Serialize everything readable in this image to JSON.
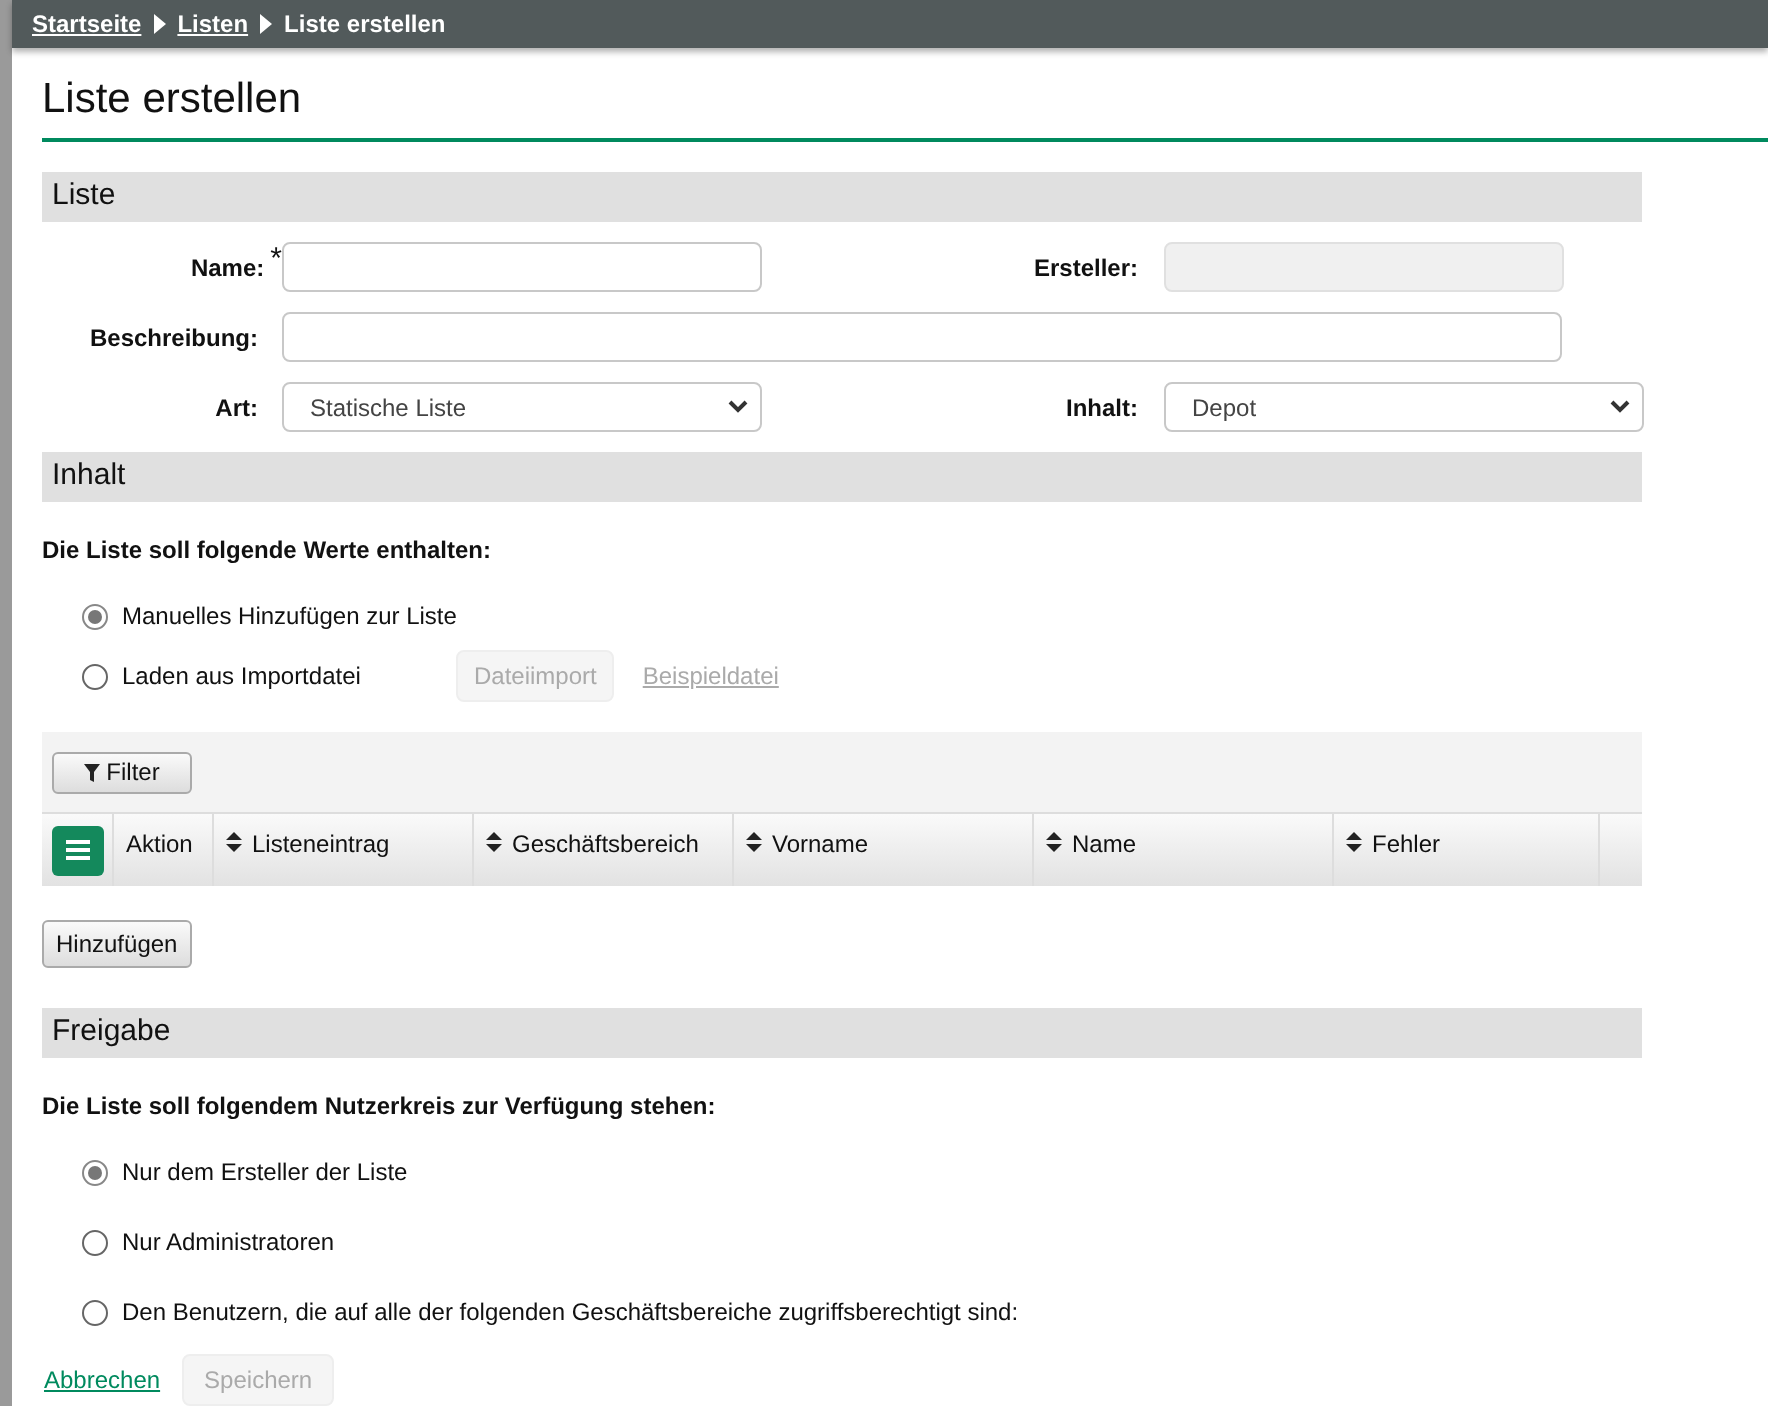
{
  "breadcrumb": [
    {
      "label": "Startseite",
      "link": true
    },
    {
      "label": "Listen",
      "link": true
    },
    {
      "label": "Liste erstellen",
      "link": false
    }
  ],
  "page_title": "Liste erstellen",
  "section_liste": {
    "title": "Liste",
    "name": {
      "label": "Name:",
      "required_mark": "*"
    },
    "ersteller": {
      "label": "Ersteller:",
      "disabled": true
    },
    "beschreibung": {
      "label": "Beschreibung:"
    },
    "art": {
      "label": "Art:",
      "value": "Statische Liste"
    },
    "inhalt": {
      "label": "Inhalt:",
      "value": "Depot"
    }
  },
  "section_inhalt": {
    "title": "Inhalt",
    "prompt": "Die Liste soll folgende Werte enthalten:",
    "options": [
      {
        "label": "Manuelles Hinzufügen zur Liste",
        "selected": true
      },
      {
        "label": "Laden aus Importdatei",
        "selected": false
      }
    ],
    "import_button": {
      "label": "Dateiimport",
      "disabled": true
    },
    "example_link": {
      "label": "Beispieldatei",
      "disabled": true
    },
    "filter_button": "Filter",
    "columns": [
      {
        "label": "Aktion",
        "sortable": false
      },
      {
        "label": "Listeneintrag",
        "sortable": true
      },
      {
        "label": "Geschäftsbereich",
        "sortable": true
      },
      {
        "label": "Vorname",
        "sortable": true
      },
      {
        "label": "Name",
        "sortable": true
      },
      {
        "label": "Fehler",
        "sortable": true
      }
    ],
    "add_button": "Hinzufügen"
  },
  "section_freigabe": {
    "title": "Freigabe",
    "prompt": "Die Liste soll folgendem Nutzerkreis zur Verfügung stehen:",
    "options": [
      {
        "label": "Nur dem Ersteller der Liste",
        "selected": true
      },
      {
        "label": "Nur Administratoren",
        "selected": false
      },
      {
        "label": "Den Benutzern, die auf alle der folgenden Geschäftsbereiche zugriffsberechtigt sind:",
        "selected": false
      }
    ]
  },
  "cancel_link": "Abbrechen",
  "save_button": {
    "label": "Speichern",
    "disabled": true
  }
}
